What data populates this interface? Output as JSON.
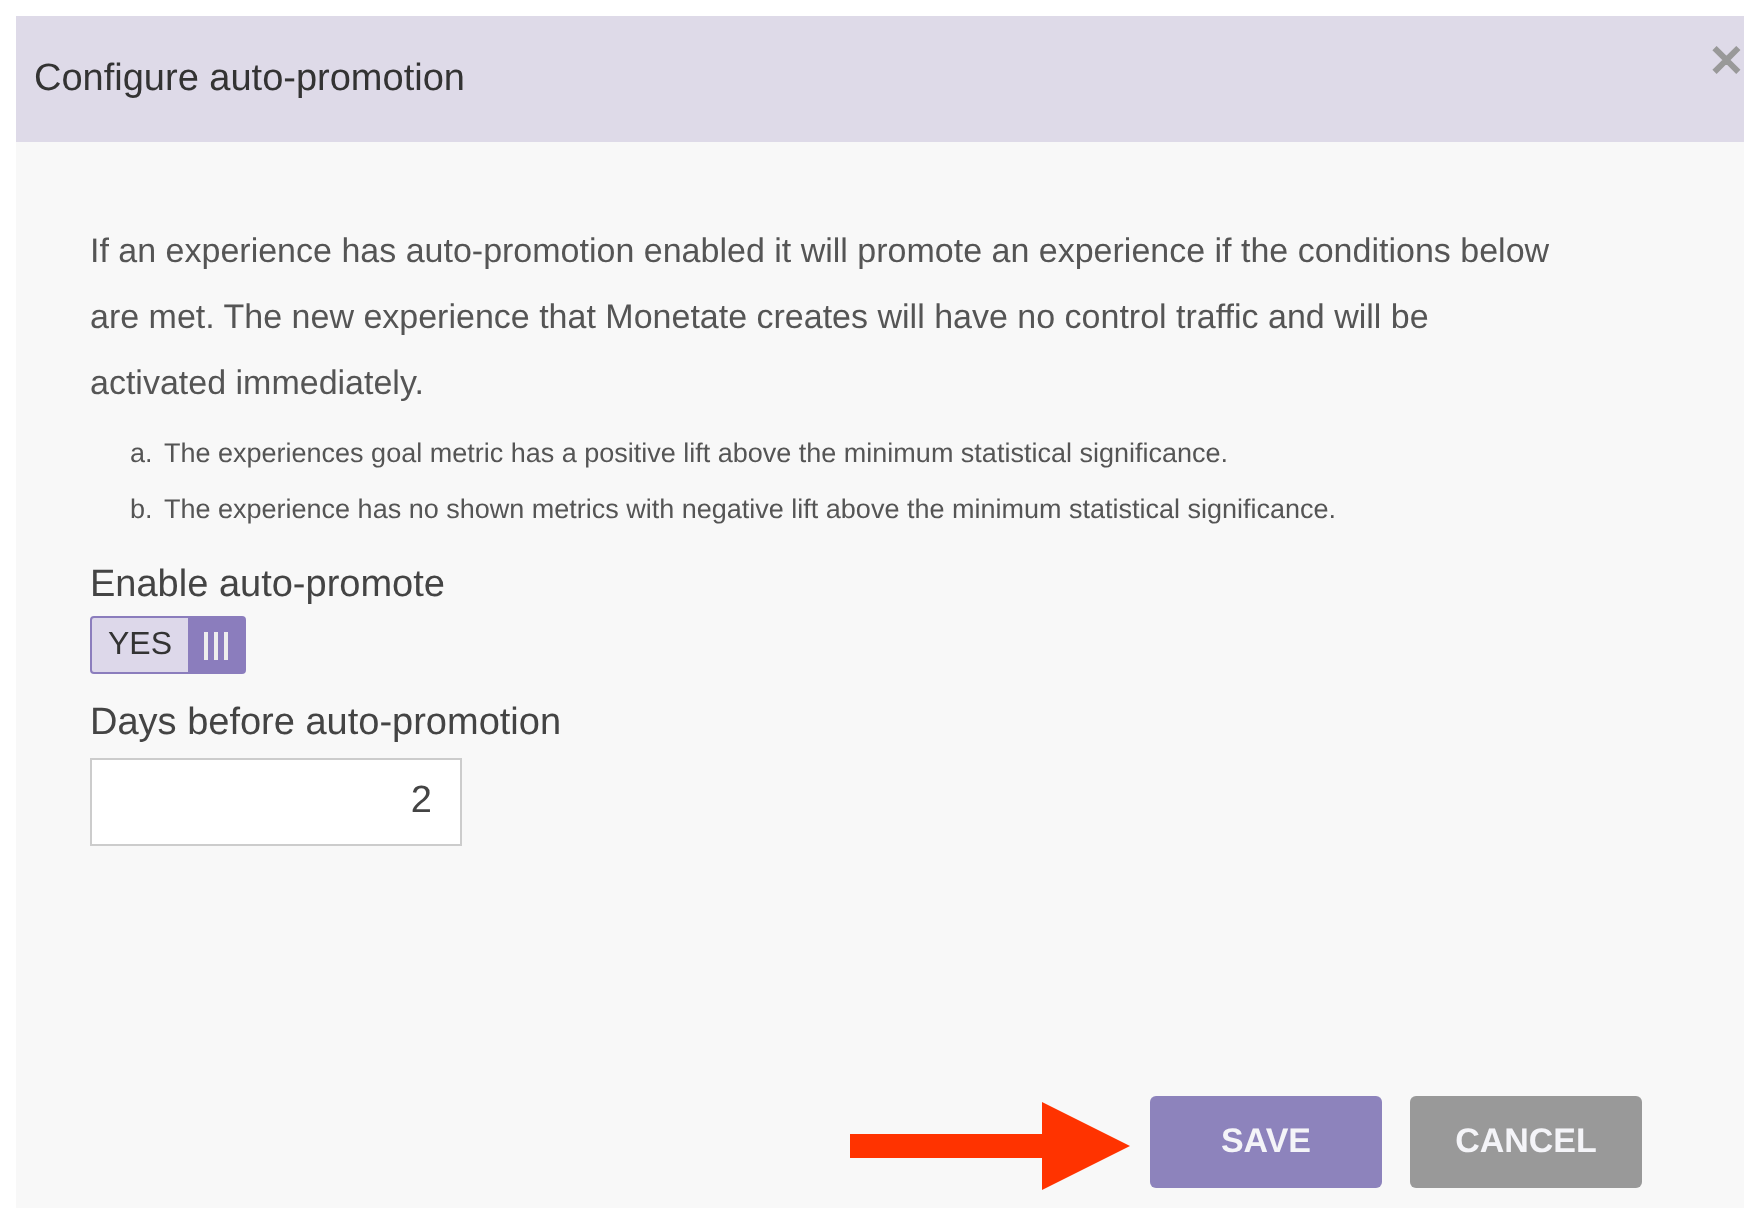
{
  "dialog": {
    "title": "Configure auto-promotion",
    "close": "✕"
  },
  "description": "If an experience has auto-promotion enabled it will promote an experience if the conditions below are met. The new experience that Monetate creates will have no control traffic and will be activated immediately.",
  "conditions": [
    {
      "marker": "a.",
      "text": "The experiences goal metric has a positive lift above the minimum statistical significance."
    },
    {
      "marker": "b.",
      "text": "The experience has no shown metrics with negative lift above the minimum statistical significance."
    }
  ],
  "enable_auto_promote": {
    "label": "Enable auto-promote",
    "value_label": "YES",
    "on": true
  },
  "days_before": {
    "label": "Days before auto-promotion",
    "value": "2"
  },
  "buttons": [
    {
      "label": "SAVE",
      "kind": "primary"
    },
    {
      "label": "CANCEL",
      "kind": "secondary"
    }
  ]
}
